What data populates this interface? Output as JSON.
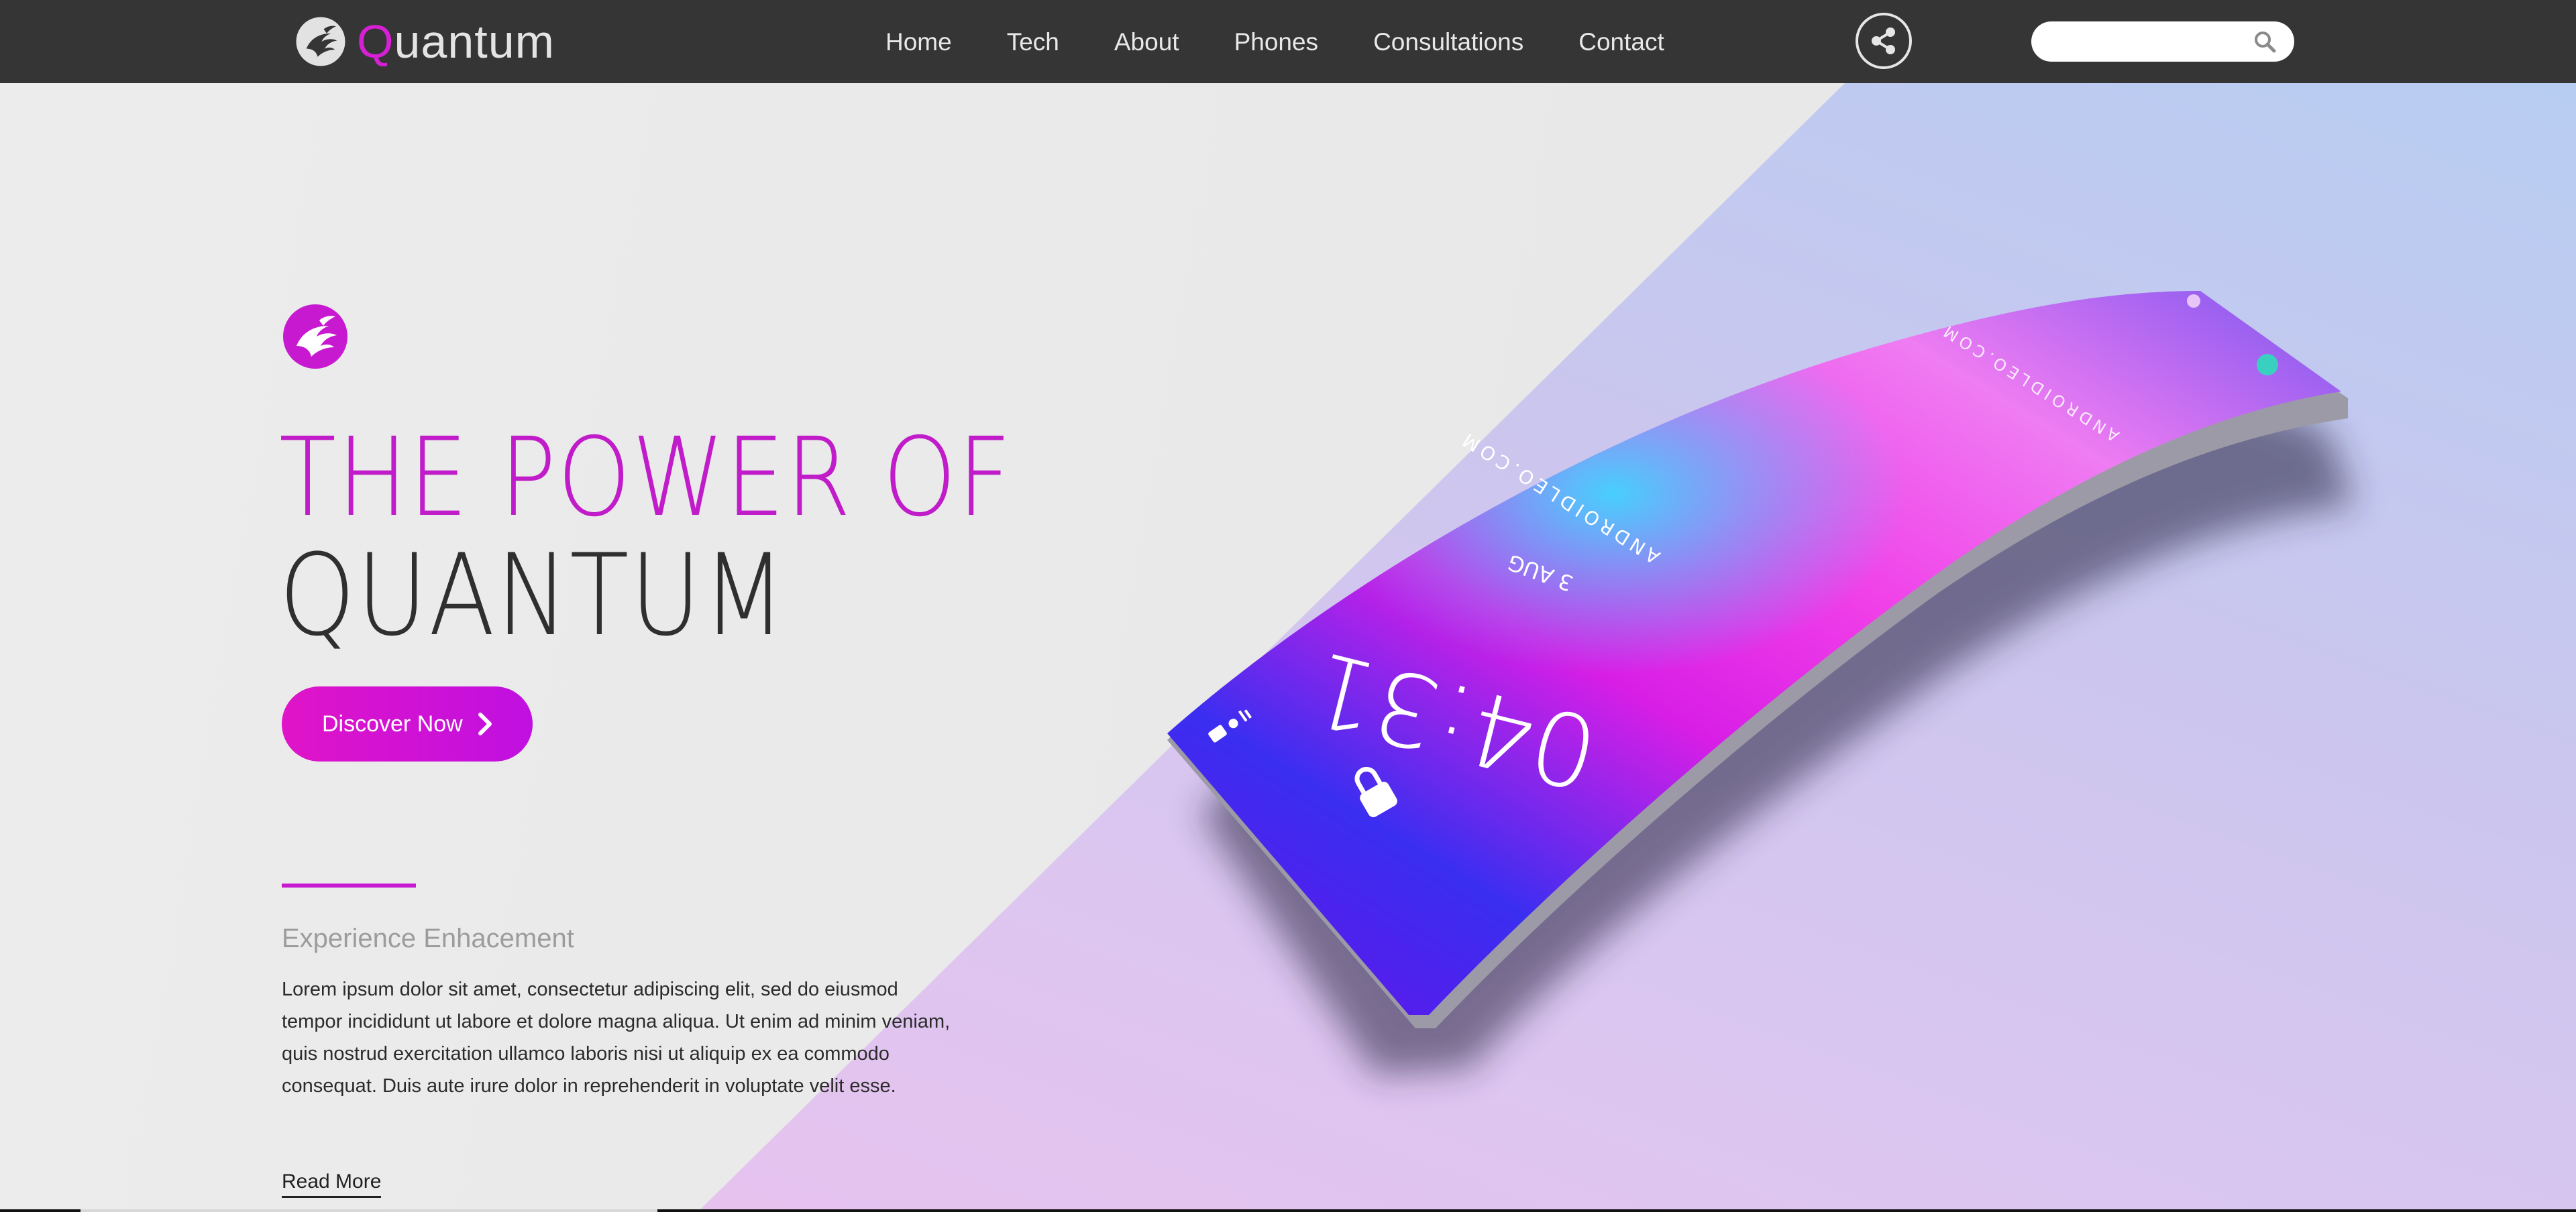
{
  "brand": {
    "first_letter": "Q",
    "rest": "uantum"
  },
  "nav": {
    "items": [
      "Home",
      "Tech",
      "About",
      "Phones",
      "Consultations",
      "Contact"
    ]
  },
  "share": {
    "icon": "share-icon"
  },
  "search": {
    "placeholder": "",
    "value": "",
    "icon": "search-icon"
  },
  "hero": {
    "title_line1": "THE POWER OF",
    "title_line2": "QUANTUM",
    "cta_label": "Discover Now",
    "subheading": "Experience Enhacement",
    "body": "Lorem ipsum dolor sit amet, consectetur adipiscing elit, sed do eiusmod tempor incididunt ut labore et dolore magna aliqua. Ut enim ad minim veniam, quis nostrud exercitation ullamco laboris nisi ut aliquip ex ea commodo consequat. Duis aute irure dolor in reprehenderit in voluptate velit esse.",
    "read_more": "Read More"
  },
  "phone": {
    "time": "04:31",
    "date": "3 AUG",
    "watermark": "ANDROIDLEO.COM"
  },
  "colors": {
    "accent": "#c71ad0",
    "nav_bg": "#353535",
    "text_dark": "#2f2f2f"
  }
}
